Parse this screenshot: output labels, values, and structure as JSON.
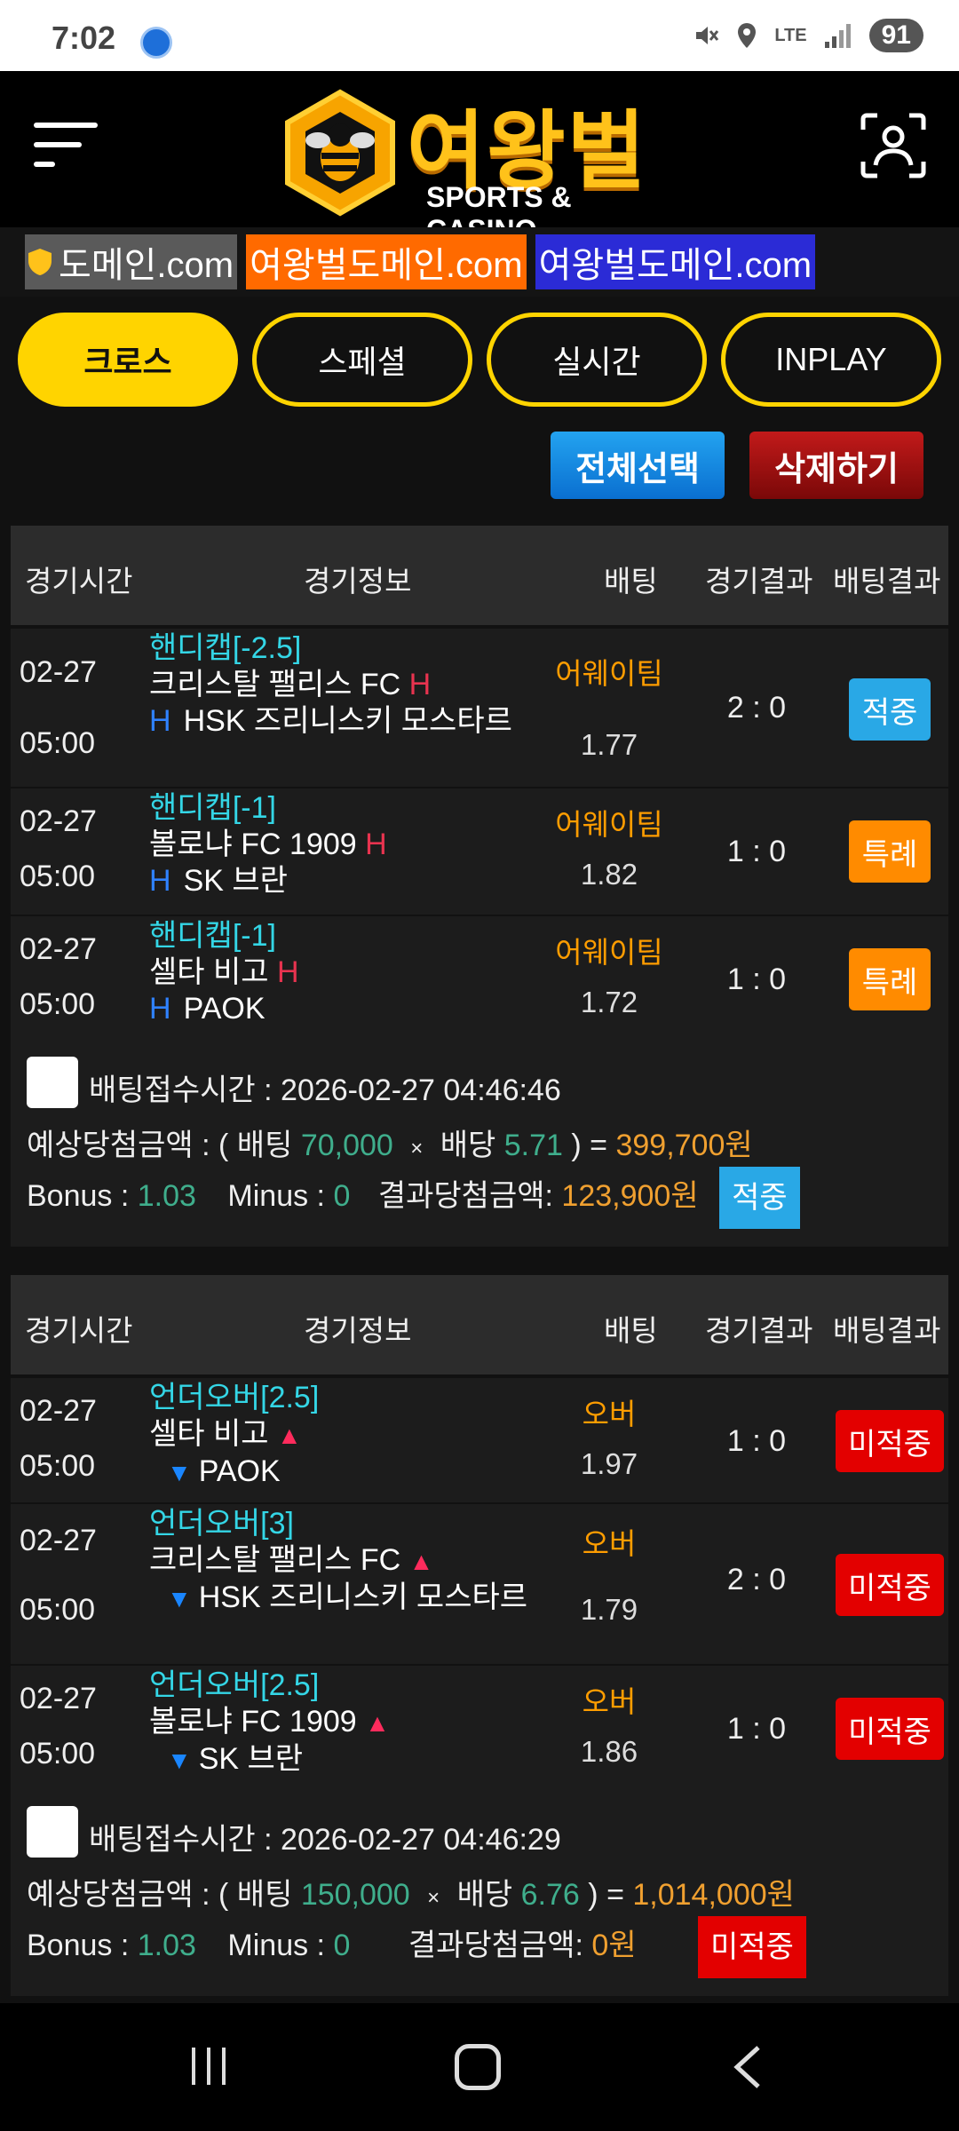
{
  "status": {
    "time": "7:02",
    "battery": "91",
    "network": "LTE",
    "badge_icon": "app-badge-icon"
  },
  "header": {
    "logo_title": "여왕벌",
    "logo_subtitle": "SPORTS & CASINO"
  },
  "banner": {
    "domain1": "도메인.com",
    "domain2": "여왕벌도메인.com",
    "domain3": "여왕벌도메인.com"
  },
  "tabs": [
    {
      "label": "크로스",
      "active": true
    },
    {
      "label": "스페셜",
      "active": false
    },
    {
      "label": "실시간",
      "active": false
    },
    {
      "label": "INPLAY",
      "active": false
    }
  ],
  "actions": {
    "select_all": "전체선택",
    "delete": "삭제하기"
  },
  "columns": {
    "time": "경기시간",
    "info": "경기정보",
    "bet": "배팅",
    "result": "경기결과",
    "outcome": "배팅결과"
  },
  "bets": [
    {
      "rows": [
        {
          "date": "02-27",
          "time": "05:00",
          "market": "핸디캡[-2.5]",
          "home": "크리스탈 팰리스 FC",
          "home_mark": "H",
          "away_mark": "H",
          "away": "HSK 즈리니스키 모스타르",
          "pick": "어웨이팀",
          "odds": "1.77",
          "score": "2 : 0",
          "outcome": "적중"
        },
        {
          "date": "02-27",
          "time": "05:00",
          "market": "핸디캡[-1]",
          "home": "볼로냐 FC 1909",
          "home_mark": "H",
          "away_mark": "H",
          "away": "SK 브란",
          "pick": "어웨이팀",
          "odds": "1.82",
          "score": "1 : 0",
          "outcome": "특례"
        },
        {
          "date": "02-27",
          "time": "05:00",
          "market": "핸디캡[-1]",
          "home": "셀타 비고",
          "home_mark": "H",
          "away_mark": "H",
          "away": "PAOK",
          "pick": "어웨이팀",
          "odds": "1.72",
          "score": "1 : 0",
          "outcome": "특례"
        }
      ],
      "summary": {
        "received_label": "배팅접수시간 :",
        "received": "2026-02-27 04:46:46",
        "expected_label": "예상당첨금액 : ( 배팅",
        "stake": "70,000",
        "times": "×",
        "odds_label": "배당",
        "total_odds": "5.71",
        "close": ") =",
        "expected": "399,700원",
        "bonus_label": "Bonus :",
        "bonus": "1.03",
        "minus_label": "Minus :",
        "minus": "0",
        "win_label": "결과당첨금액:",
        "win_amount": "123,900원",
        "result": "적중"
      }
    },
    {
      "rows": [
        {
          "date": "02-27",
          "time": "05:00",
          "market": "언더오버[2.5]",
          "home": "셀타 비고",
          "home_mark": "▲",
          "away_mark": "▼",
          "away": "PAOK",
          "pick": "오버",
          "odds": "1.97",
          "score": "1 : 0",
          "outcome": "미적중"
        },
        {
          "date": "02-27",
          "time": "05:00",
          "market": "언더오버[3]",
          "home": "크리스탈 팰리스 FC",
          "home_mark": "▲",
          "away_mark": "▼",
          "away": "HSK 즈리니스키 모스타르",
          "pick": "오버",
          "odds": "1.79",
          "score": "2 : 0",
          "outcome": "미적중"
        },
        {
          "date": "02-27",
          "time": "05:00",
          "market": "언더오버[2.5]",
          "home": "볼로냐 FC 1909",
          "home_mark": "▲",
          "away_mark": "▼",
          "away": "SK 브란",
          "pick": "오버",
          "odds": "1.86",
          "score": "1 : 0",
          "outcome": "미적중"
        }
      ],
      "summary": {
        "received_label": "배팅접수시간 :",
        "received": "2026-02-27 04:46:29",
        "expected_label": "예상당첨금액 : ( 배팅",
        "stake": "150,000",
        "times": "×",
        "odds_label": "배당",
        "total_odds": "6.76",
        "close": ") =",
        "expected": "1,014,000원",
        "bonus_label": "Bonus :",
        "bonus": "1.03",
        "minus_label": "Minus :",
        "minus": "0",
        "win_label": "결과당첨금액:",
        "win_amount": "0원",
        "result": "미적중"
      }
    }
  ],
  "colors": {
    "accent_yellow": "#ffd400",
    "win_blue": "#29a8e6",
    "special_orange": "#ff8b00",
    "lose_red": "#e30000"
  }
}
